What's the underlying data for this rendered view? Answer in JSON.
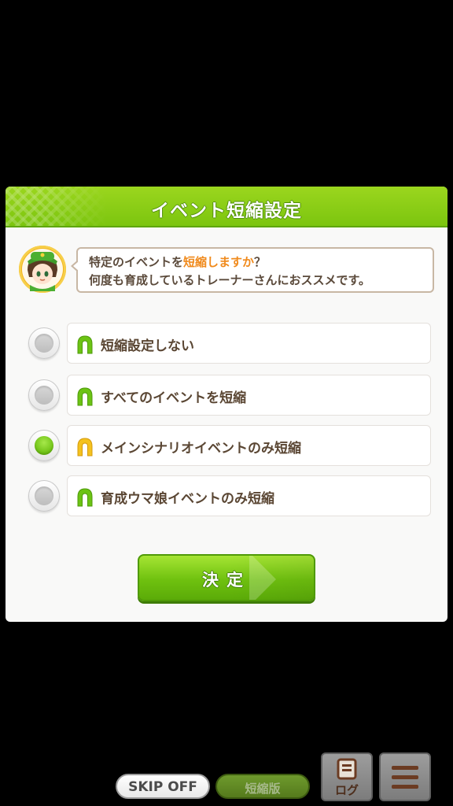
{
  "dialog": {
    "title": "イベント短縮設定",
    "message_line1_a": "特定のイベントを",
    "message_line1_hl": "短縮しますか",
    "message_line1_b": "？",
    "message_line2": "何度も育成しているトレーナーさんにおススメです。",
    "options": [
      {
        "label": "短縮設定しない",
        "selected": false,
        "icon": "horseshoe-icon-green"
      },
      {
        "label": "すべてのイベントを短縮",
        "selected": false,
        "icon": "horseshoe-icon-green"
      },
      {
        "label": "メインシナリオイベントのみ短縮",
        "selected": true,
        "icon": "horseshoe-icon-gold"
      },
      {
        "label": "育成ウマ娘イベントのみ短縮",
        "selected": false,
        "icon": "horseshoe-icon-green"
      }
    ],
    "confirm_label": "決定"
  },
  "bottom_bar": {
    "skip_label": "SKIP OFF",
    "short_label": "短縮版",
    "log_label": "ログ"
  },
  "colors": {
    "accent_green": "#7cc50f",
    "highlight_orange": "#f08a1c",
    "text_brown": "#5a4633"
  }
}
